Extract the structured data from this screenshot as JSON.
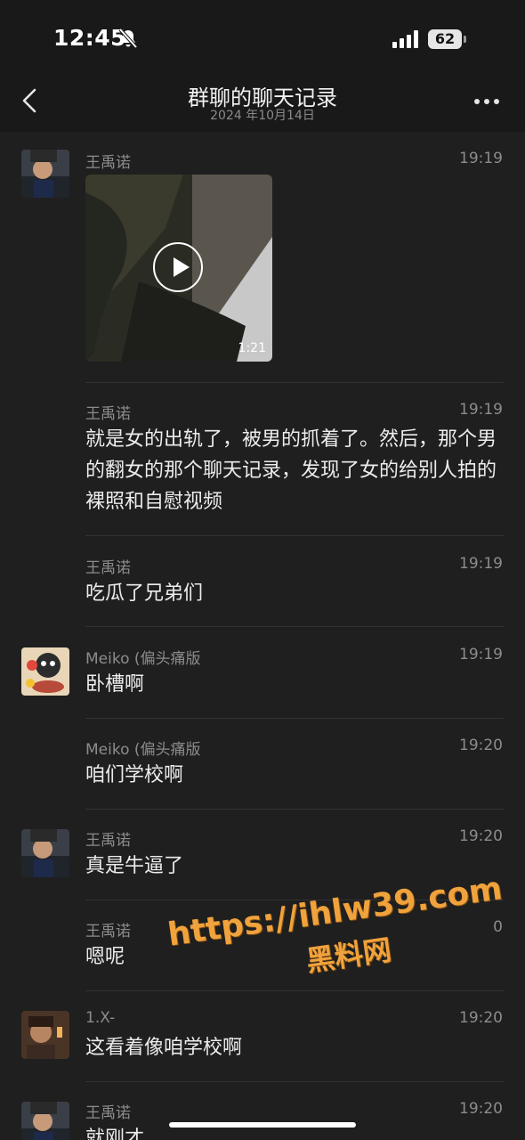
{
  "status": {
    "time": "12:45",
    "battery": "62"
  },
  "header": {
    "title": "群聊的聊天记录",
    "date": "2024 年10月14日"
  },
  "messages": [
    {
      "sender": "王禹诺",
      "time": "19:19",
      "type": "video",
      "duration": "1:21"
    },
    {
      "sender": "王禹诺",
      "time": "19:19",
      "text": "就是女的出轨了，被男的抓着了。然后，那个男的翻女的那个聊天记录，发现了女的给别人拍的裸照和自慰视频"
    },
    {
      "sender": "王禹诺",
      "time": "19:19",
      "text": "吃瓜了兄弟们"
    },
    {
      "sender": "Meiko (偏头痛版",
      "time": "19:19",
      "text": "卧槽啊"
    },
    {
      "sender": "Meiko (偏头痛版",
      "time": "19:20",
      "text": "咱们学校啊"
    },
    {
      "sender": "王禹诺",
      "time": "19:20",
      "text": "真是牛逼了"
    },
    {
      "sender": "王禹诺",
      "time": "0",
      "text": "嗯呢"
    },
    {
      "sender": "1.X-",
      "time": "19:20",
      "text": "这看着像咱学校啊"
    },
    {
      "sender": "王禹诺",
      "time": "19:20",
      "text": "就刚才"
    }
  ],
  "watermark": {
    "url": "https://ihlw39.com",
    "label": "黑料网"
  }
}
